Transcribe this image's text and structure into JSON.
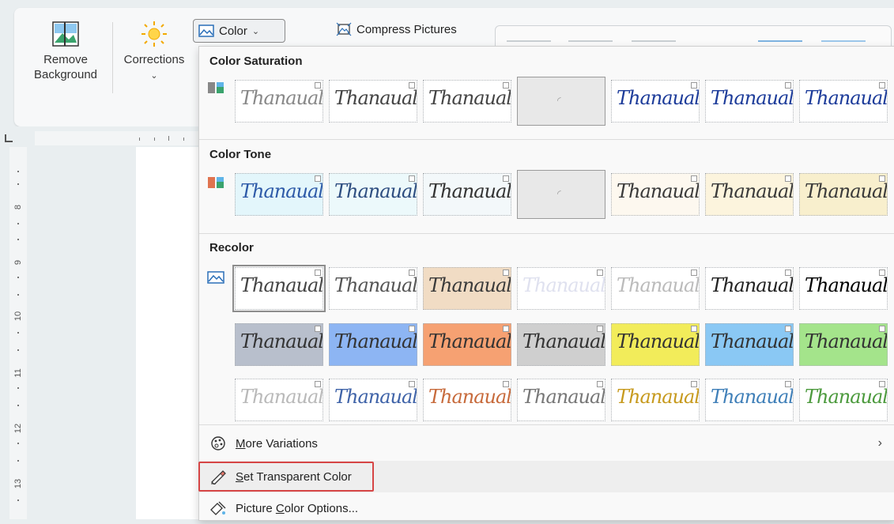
{
  "ribbon": {
    "remove_background_line1": "Remove",
    "remove_background_line2": "Background",
    "corrections_label": "Corrections",
    "color_label": "Color",
    "compress_label": "Compress Pictures"
  },
  "ruler": {
    "numbers": [
      "8",
      "9",
      "10",
      "11",
      "12",
      "13"
    ]
  },
  "dropdown": {
    "color_saturation": {
      "title": "Color Saturation"
    },
    "color_tone": {
      "title": "Color Tone"
    },
    "recolor": {
      "title": "Recolor"
    },
    "signature_text": "Thanaual",
    "menu": {
      "more_variations_accel": "M",
      "more_variations_rest": "ore Variations",
      "set_transparent_accel": "S",
      "set_transparent_rest": "et Transparent Color",
      "picture_options_pre": "Picture ",
      "picture_options_accel": "C",
      "picture_options_rest": "olor Options..."
    }
  },
  "colors": {
    "accent_highlight": "#d64545",
    "menu_hover": "#eeeeee"
  }
}
